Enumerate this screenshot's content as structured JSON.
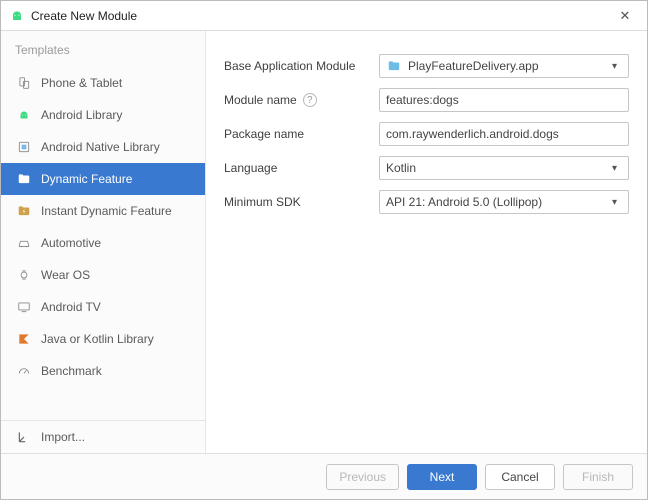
{
  "title": "Create New Module",
  "sidebar": {
    "header": "Templates",
    "import_label": "Import...",
    "items": [
      {
        "label": "Phone & Tablet",
        "icon": "phone-tablet"
      },
      {
        "label": "Android Library",
        "icon": "android"
      },
      {
        "label": "Android Native Library",
        "icon": "native"
      },
      {
        "label": "Dynamic Feature",
        "icon": "folder"
      },
      {
        "label": "Instant Dynamic Feature",
        "icon": "folder-bolt"
      },
      {
        "label": "Automotive",
        "icon": "car"
      },
      {
        "label": "Wear OS",
        "icon": "watch"
      },
      {
        "label": "Android TV",
        "icon": "tv"
      },
      {
        "label": "Java or Kotlin Library",
        "icon": "kotlin"
      },
      {
        "label": "Benchmark",
        "icon": "gauge"
      }
    ],
    "selected_index": 3
  },
  "form": {
    "base_module": {
      "label": "Base Application Module",
      "value": "PlayFeatureDelivery.app"
    },
    "module_name": {
      "label": "Module name",
      "value": "features:dogs"
    },
    "package_name": {
      "label": "Package name",
      "value": "com.raywenderlich.android.dogs"
    },
    "language": {
      "label": "Language",
      "value": "Kotlin"
    },
    "min_sdk": {
      "label": "Minimum SDK",
      "value": "API 21: Android 5.0 (Lollipop)"
    }
  },
  "buttons": {
    "previous": "Previous",
    "next": "Next",
    "cancel": "Cancel",
    "finish": "Finish"
  }
}
